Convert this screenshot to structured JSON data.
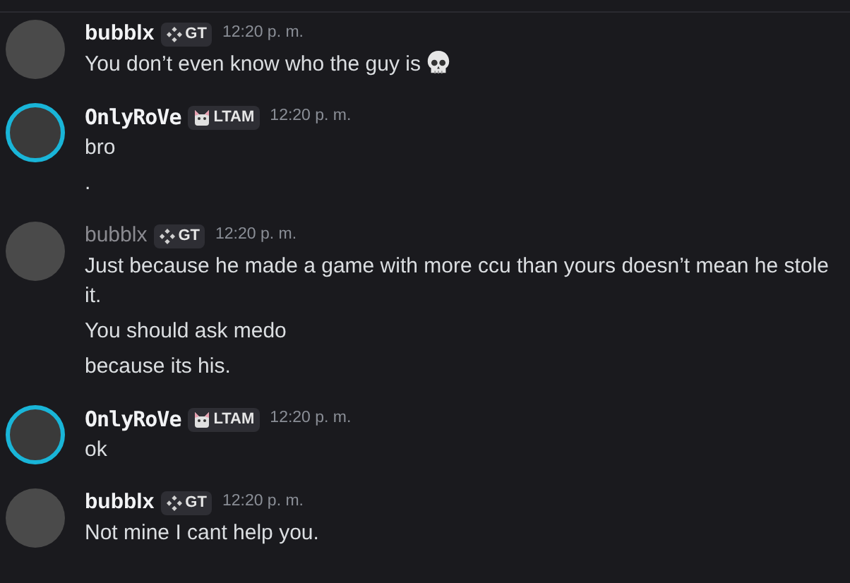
{
  "messages": [
    {
      "kind": "plain",
      "author": "bubblx",
      "author_dimmed": false,
      "badge": "GT",
      "time": "12:20 p. m.",
      "lines": [
        {
          "kind": "with-emoji",
          "text": "You don’t even know who the guy is"
        }
      ]
    },
    {
      "kind": "decorated",
      "author": "OnlyRoVe",
      "author_dimmed": false,
      "badge": "LTAM",
      "time": "12:20 p. m.",
      "lines": [
        {
          "kind": "text",
          "text": "bro"
        },
        {
          "kind": "text",
          "text": "."
        }
      ]
    },
    {
      "kind": "plain",
      "author": "bubblx",
      "author_dimmed": true,
      "badge": "GT",
      "time": "12:20 p. m.",
      "lines": [
        {
          "kind": "text",
          "text": "Just because he made a game with more ccu than yours doesn’t mean he stole it."
        },
        {
          "kind": "text",
          "text": "You should ask medo"
        },
        {
          "kind": "text",
          "text": "because its his."
        }
      ]
    },
    {
      "kind": "decorated",
      "author": "OnlyRoVe",
      "author_dimmed": false,
      "badge": "LTAM",
      "time": "12:20 p. m.",
      "lines": [
        {
          "kind": "text",
          "text": "ok"
        }
      ]
    },
    {
      "kind": "plain",
      "author": "bubblx",
      "author_dimmed": false,
      "badge": "GT",
      "time": "12:20 p. m.",
      "lines": [
        {
          "kind": "text",
          "text": "Not mine I cant help you."
        }
      ]
    }
  ]
}
